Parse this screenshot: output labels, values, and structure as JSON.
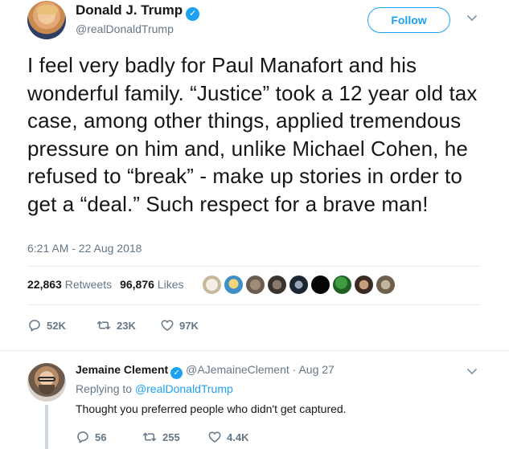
{
  "tweet": {
    "author_name": "Donald J. Trump",
    "author_handle": "@realDonaldTrump",
    "follow_label": "Follow",
    "text": "I feel very badly for Paul Manafort and his wonderful family. “Justice” took a 12 year old tax case, among other things, applied tremendous pressure on him and, unlike Michael Cohen, he refused to “break” - make up stories in order to get a “deal.” Such respect for a brave man!",
    "timestamp": "6:21 AM - 22 Aug 2018",
    "retweets_count": "22,863",
    "retweets_label": "Retweets",
    "likes_count": "96,876",
    "likes_label": "Likes",
    "reply_count": "52K",
    "retweet_action_count": "23K",
    "like_action_count": "97K"
  },
  "reply": {
    "author_name": "Jemaine Clement",
    "author_handle": "@AJemaineClement",
    "date": "· Aug 27",
    "replying_prefix": "Replying to",
    "replying_to": "@realDonaldTrump",
    "text": "Thought you preferred people who didn't get captured.",
    "reply_count": "56",
    "retweet_count": "255",
    "like_count": "4.4K"
  },
  "icons": {
    "verified": "verified-badge-icon",
    "chevron": "chevron-down-icon",
    "reply": "reply-icon",
    "retweet": "retweet-icon",
    "like": "heart-icon"
  },
  "colors": {
    "accent": "#1da1f2",
    "muted": "#657786",
    "text": "#14171a",
    "divider": "#e6ecf0"
  }
}
